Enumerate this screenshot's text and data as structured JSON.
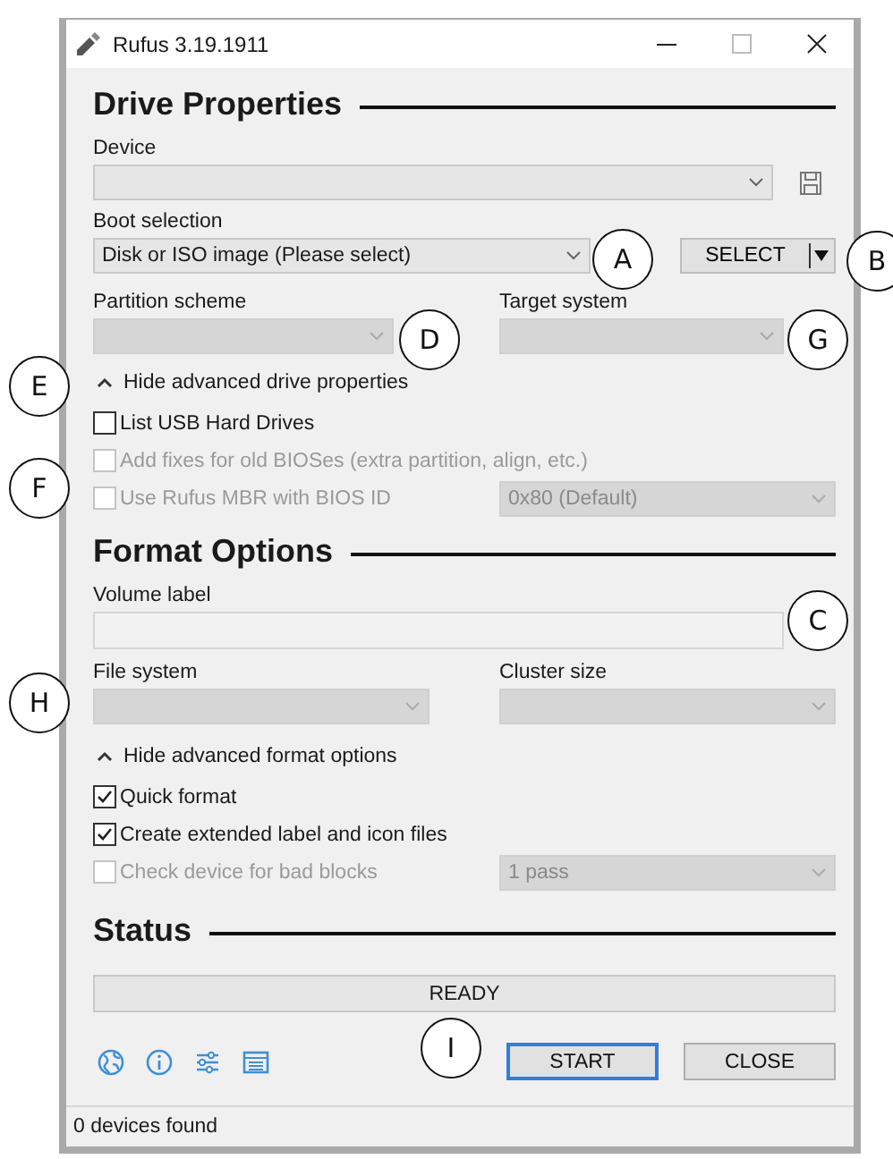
{
  "window": {
    "title": "Rufus 3.19.1911"
  },
  "drive_properties": {
    "heading": "Drive Properties",
    "device": {
      "label": "Device",
      "disabled": false
    },
    "boot_selection": {
      "label": "Boot selection",
      "value": "Disk or ISO image (Please select)",
      "disabled": false
    },
    "select_button": "SELECT",
    "partition_scheme": {
      "label": "Partition scheme",
      "disabled": true
    },
    "target_system": {
      "label": "Target system",
      "disabled": true
    },
    "advanced_toggle": {
      "label": "Hide advanced drive properties",
      "expanded": true
    },
    "options": [
      {
        "label": "List USB Hard Drives",
        "checked": false,
        "disabled": false
      },
      {
        "label": "Add fixes for old BIOSes (extra partition, align, etc.)",
        "checked": false,
        "disabled": true
      },
      {
        "label": "Use Rufus MBR with BIOS ID",
        "checked": false,
        "disabled": true,
        "dropdown": {
          "value": "0x80 (Default)",
          "disabled": true
        }
      }
    ]
  },
  "format_options": {
    "heading": "Format Options",
    "volume_label": {
      "label": "Volume label"
    },
    "file_system": {
      "label": "File system",
      "disabled": true
    },
    "cluster_size": {
      "label": "Cluster size",
      "disabled": true
    },
    "advanced_toggle": {
      "label": "Hide advanced format options",
      "expanded": true
    },
    "options": [
      {
        "label": "Quick format",
        "checked": true,
        "disabled": false
      },
      {
        "label": "Create extended label and icon files",
        "checked": true,
        "disabled": false
      },
      {
        "label": "Check device for bad blocks",
        "checked": false,
        "disabled": true,
        "dropdown": {
          "value": "1 pass",
          "disabled": true
        }
      }
    ]
  },
  "status": {
    "heading": "Status",
    "progress": "READY"
  },
  "buttons": [
    {
      "label": "START",
      "focused": true
    },
    {
      "label": "CLOSE",
      "focused": false
    }
  ],
  "status_bar": "0 devices found",
  "callouts": [
    {
      "label": "A"
    },
    {
      "label": "B"
    },
    {
      "label": "D"
    },
    {
      "label": "G"
    },
    {
      "label": "E"
    },
    {
      "label": "F"
    },
    {
      "label": "C"
    },
    {
      "label": "H"
    },
    {
      "label": "I"
    }
  ]
}
